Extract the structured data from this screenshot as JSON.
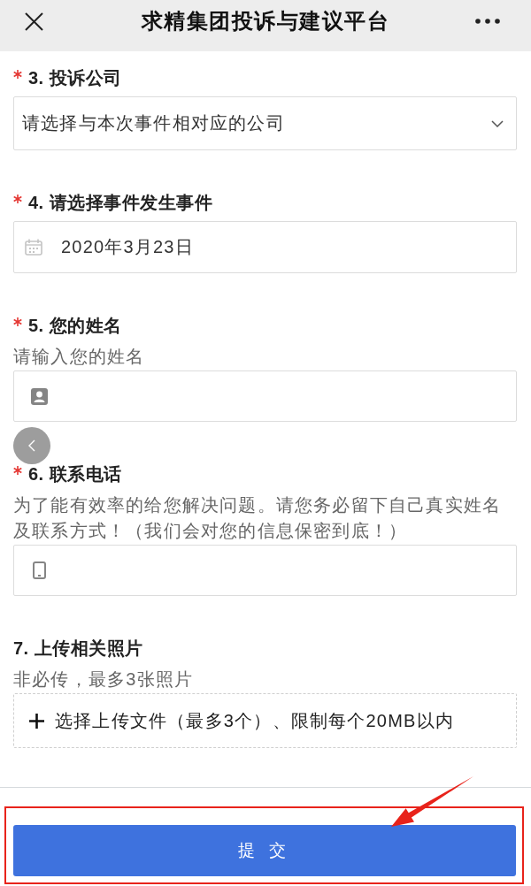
{
  "header": {
    "title": "求精集团投诉与建议平台"
  },
  "questions": [
    {
      "kind": "select",
      "label": "3. 投诉公司",
      "required": true,
      "placeholder": "请选择与本次事件相对应的公司"
    },
    {
      "kind": "date",
      "label": "4. 请选择事件发生事件",
      "required": true,
      "value": "2020年3月23日"
    },
    {
      "kind": "text",
      "label": "5. 您的姓名",
      "required": true,
      "hint": "请输入您的姓名"
    },
    {
      "kind": "phone",
      "label": "6. 联系电话",
      "required": true,
      "hint": "为了能有效率的给您解决问题。请您务必留下自己真实姓名及联系方式！（我们会对您的信息保密到底！）"
    },
    {
      "kind": "upload",
      "label": "7. 上传相关照片",
      "required": false,
      "hint": "非必传，最多3张照片",
      "button": "选择上传文件（最多3个）、限制每个20MB以内"
    }
  ],
  "submit_button": "提 交",
  "annotations": {
    "highlight_frame": true,
    "arrow": true
  }
}
